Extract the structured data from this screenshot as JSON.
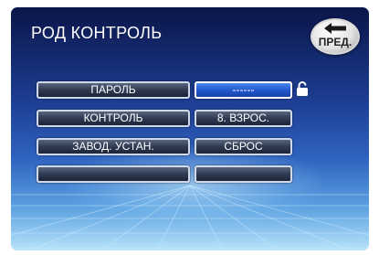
{
  "header": {
    "title": "РОД КОНТРОЛЬ"
  },
  "back_button": {
    "label": "ПРЕД."
  },
  "menu": {
    "rows": [
      {
        "label": "ПАРОЛЬ",
        "value": "------"
      },
      {
        "label": "КОНТРОЛЬ",
        "value": "8. ВЗРОС."
      },
      {
        "label": "ЗАВОД. УСТАН.",
        "value": "СБРОС"
      },
      {
        "label": "",
        "value": ""
      }
    ]
  },
  "colors": {
    "accent": "#2055cc",
    "background_top": "#0b1548",
    "background_bottom": "#b8e4fb"
  },
  "icons": {
    "back": "back-arrow-icon",
    "lock": "padlock-icon"
  }
}
